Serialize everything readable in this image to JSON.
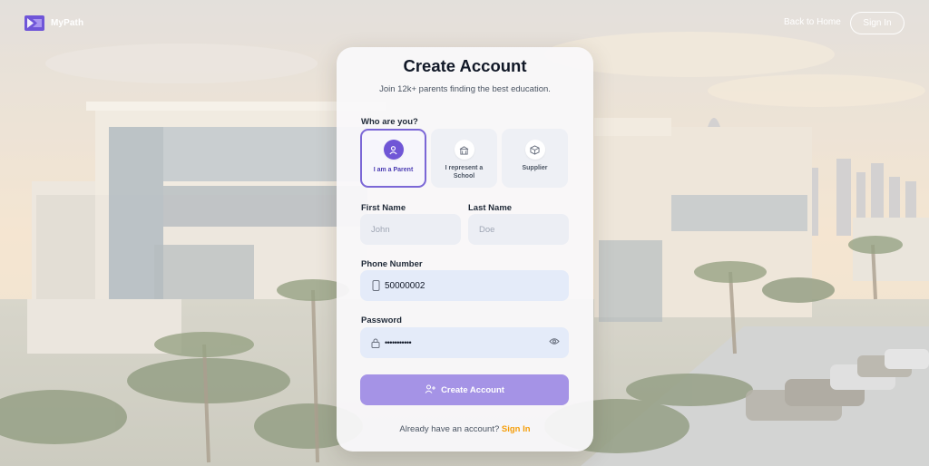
{
  "brand": {
    "name": "MyPath",
    "color": "#6f55d8"
  },
  "nav": {
    "back_home": "Back to Home",
    "sign_in": "Sign In"
  },
  "card": {
    "title": "Create Account",
    "subtitle": "Join 12k+ parents finding the best education.",
    "role_question": "Who are you?",
    "roles": [
      {
        "label": "I am a Parent",
        "icon": "user-icon",
        "selected": true
      },
      {
        "label": "I represent a School",
        "icon": "school-icon",
        "selected": false
      },
      {
        "label": "Supplier",
        "icon": "box-icon",
        "selected": false
      }
    ],
    "first_name": {
      "label": "First Name",
      "placeholder": "John",
      "value": ""
    },
    "last_name": {
      "label": "Last Name",
      "placeholder": "Doe",
      "value": ""
    },
    "phone": {
      "label": "Phone Number",
      "value": "50000002",
      "icon": "phone-icon"
    },
    "password": {
      "label": "Password",
      "value": "•••••••••••",
      "icon": "lock-icon",
      "toggle_icon": "eye-icon"
    },
    "submit": {
      "label": "Create Account",
      "icon": "user-plus-icon"
    },
    "footer": {
      "text": "Already have an account?",
      "link": "Sign In"
    }
  },
  "colors": {
    "accent": "#7056d6",
    "button": "#a593e6",
    "link": "#f59e0b",
    "field_focus": "#e4ebf9"
  }
}
